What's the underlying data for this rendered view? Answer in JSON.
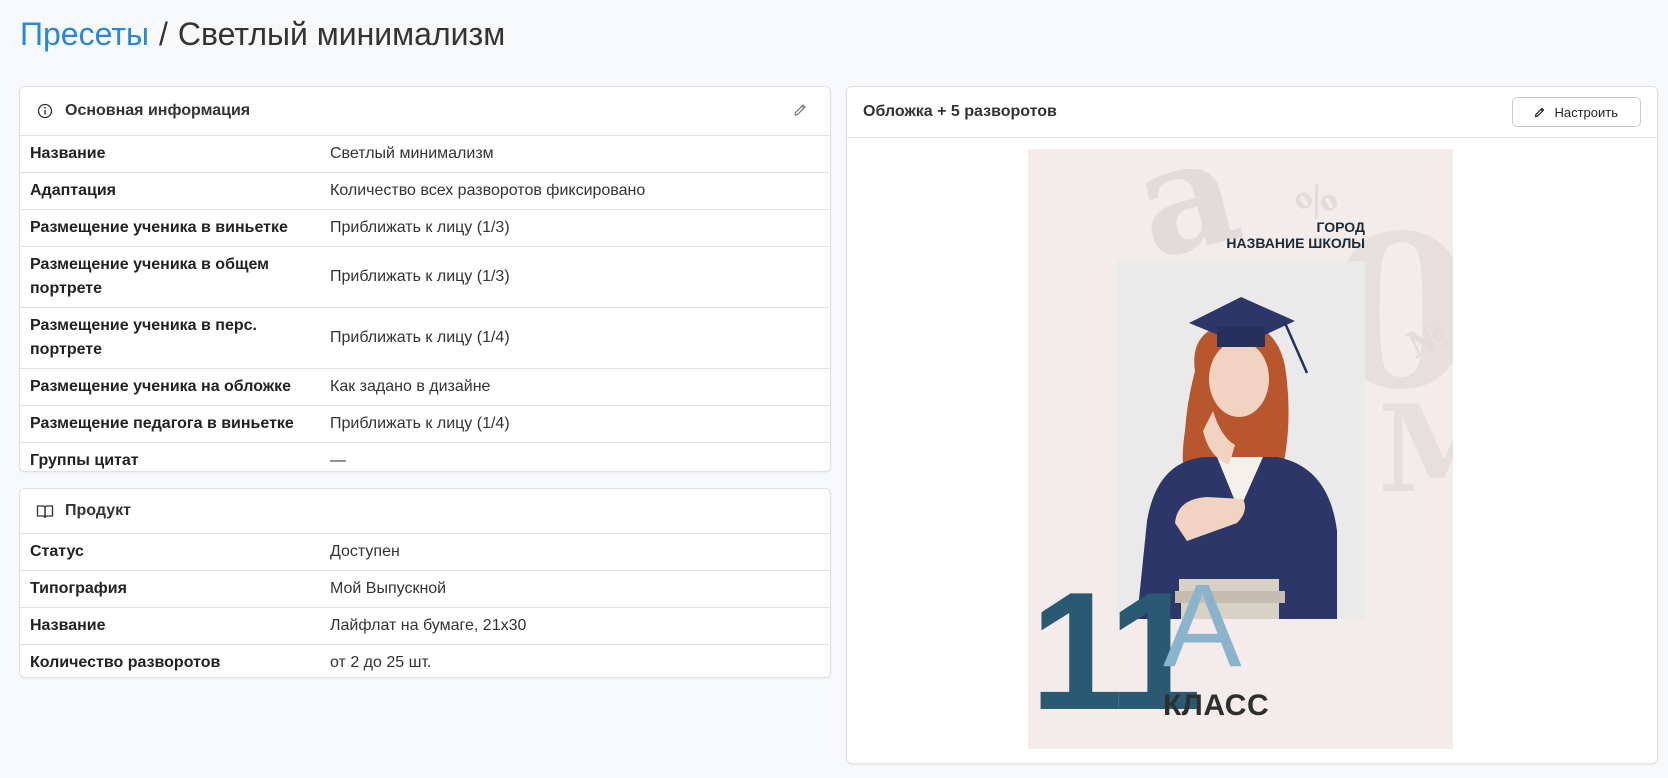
{
  "breadcrumb": {
    "root": "Пресеты",
    "separator": "/",
    "current": "Светлый минимализм"
  },
  "basic_info": {
    "title": "Основная информация",
    "rows": [
      {
        "key": "Название",
        "value": "Светлый минимализм"
      },
      {
        "key": "Адаптация",
        "value": "Количество всех разворотов фиксировано"
      },
      {
        "key": "Размещение ученика в виньетке",
        "value": "Приближать к лицу (1/3)"
      },
      {
        "key": "Размещение ученика в общем портрете",
        "value": "Приближать к лицу (1/3)"
      },
      {
        "key": "Размещение ученика в перс. портрете",
        "value": "Приближать к лицу (1/4)"
      },
      {
        "key": "Размещение ученика на обложке",
        "value": "Как задано в дизайне"
      },
      {
        "key": "Размещение педагога в виньетке",
        "value": "Приближать к лицу (1/4)"
      },
      {
        "key": "Группы цитат",
        "value": "—"
      }
    ]
  },
  "product": {
    "title": "Продукт",
    "rows": [
      {
        "key": "Статус",
        "value": "Доступен"
      },
      {
        "key": "Типография",
        "value": "Мой Выпускной"
      },
      {
        "key": "Название",
        "value": "Лайфлат на бумаге, 21х30"
      },
      {
        "key": "Количество разворотов",
        "value": "от 2 до 25 шт."
      }
    ]
  },
  "preview": {
    "title": "Обложка + 5 разворотов",
    "configure_label": "Настроить",
    "cover": {
      "city": "ГОРОД",
      "school": "НАЗВАНИЕ ШКОЛЫ",
      "number": "11",
      "letter": "А",
      "class_label": "КЛАСС"
    }
  },
  "colors": {
    "link": "#2b87d3",
    "cover_background": "#f4ecea",
    "cover_number": "#2a5a72",
    "cover_letter": "#8bb3cb"
  }
}
